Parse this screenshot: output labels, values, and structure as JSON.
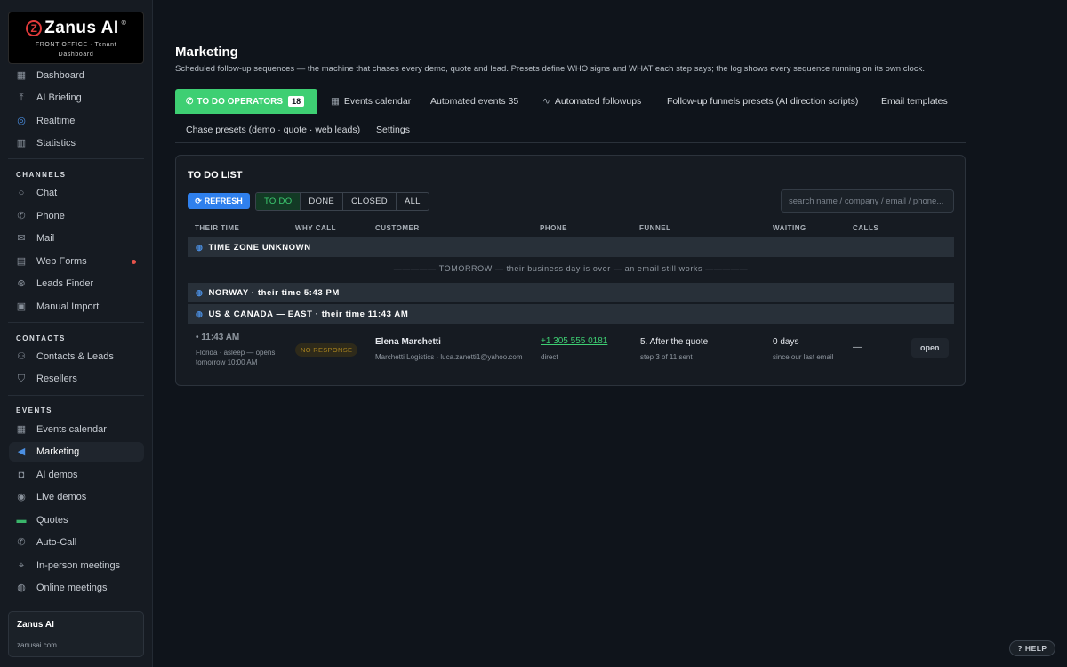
{
  "logo": {
    "letter": "Z",
    "name": "Zanus AI",
    "reg": "®",
    "sub1": "FRONT OFFICE · Tenant",
    "sub2": "Dashboard"
  },
  "sidebar": {
    "top_items": [
      {
        "label": "Dashboard",
        "icon": "grid-icon"
      },
      {
        "label": "AI Briefing",
        "icon": "upload-icon"
      },
      {
        "label": "Realtime",
        "icon": "globe-icon"
      },
      {
        "label": "Statistics",
        "icon": "bar-chart-icon"
      }
    ],
    "channels_label": "CHANNELS",
    "channels": [
      {
        "label": "Chat",
        "icon": "chat-icon"
      },
      {
        "label": "Phone",
        "icon": "phone-icon"
      },
      {
        "label": "Mail",
        "icon": "mail-icon"
      },
      {
        "label": "Web Forms",
        "icon": "form-icon"
      },
      {
        "label": "Leads Finder",
        "icon": "target-icon"
      },
      {
        "label": "Manual Import",
        "icon": "import-icon"
      }
    ],
    "contacts_label": "CONTACTS",
    "contacts": [
      {
        "label": "Contacts & Leads",
        "icon": "users-icon"
      },
      {
        "label": "Resellers",
        "icon": "handshake-icon"
      }
    ],
    "events_label": "EVENTS",
    "events": [
      {
        "label": "Events calendar",
        "icon": "calendar-icon"
      },
      {
        "label": "Marketing",
        "icon": "megaphone-icon"
      },
      {
        "label": "AI demos",
        "icon": "robot-icon"
      },
      {
        "label": "Live demos",
        "icon": "video-icon"
      },
      {
        "label": "Quotes",
        "icon": "quote-icon"
      },
      {
        "label": "Auto-Call",
        "icon": "auto-call-icon"
      },
      {
        "label": "In-person meetings",
        "icon": "pin-icon"
      },
      {
        "label": "Online meetings",
        "icon": "online-meeting-icon"
      }
    ],
    "brand": {
      "name": "Zanus AI",
      "url": "zanusai.com"
    }
  },
  "page": {
    "title": "Marketing",
    "description": "Scheduled follow-up sequences — the machine that chases every demo, quote and lead. Presets define WHO signs and WHAT each step says; the log shows every sequence running on its own clock."
  },
  "tabs": {
    "todo_label": "TO DO OPERATORS",
    "todo_count": "18",
    "events_calendar": "Events calendar",
    "automated_events": "Automated events 35",
    "automated_followups": "Automated followups",
    "funnels_presets": "Follow-up funnels presets (AI direction scripts)",
    "email_templates": "Email templates",
    "chase_presets": "Chase presets (demo · quote · web leads)",
    "settings": "Settings"
  },
  "todo": {
    "title": "TO DO LIST",
    "refresh": "REFRESH",
    "filters": [
      "TO DO",
      "DONE",
      "CLOSED",
      "ALL"
    ],
    "search_placeholder": "search name / company / email / phone...",
    "columns": [
      "THEIR TIME",
      "WHY CALL",
      "CUSTOMER",
      "PHONE",
      "FUNNEL",
      "WAITING",
      "CALLS"
    ],
    "groups": {
      "unknown": "TIME ZONE UNKNOWN",
      "tomorrow": "————— TOMORROW — their business day is over — an email still works —————",
      "norway": "NORWAY · their time 5:43 PM",
      "us_east": "US & CANADA — EAST · their time 11:43 AM"
    },
    "row": {
      "time": "• 11:43 AM",
      "time_sub1": "Florida · asleep — opens",
      "time_sub2": "tomorrow 10:00 AM",
      "why": "NO RESPONSE",
      "name": "Elena Marchetti",
      "company": "Marchetti Logistics · luca.zanetti1@yahoo.com",
      "phone": "+1 305 555 0181",
      "phone_sub": "direct",
      "funnel": "5. After the quote",
      "funnel_sub": "step 3 of 11 sent",
      "waiting": "0 days",
      "waiting_sub": "since our last email",
      "calls": "—",
      "action": "open"
    }
  },
  "help": "? HELP",
  "colors": {
    "accent_green": "#3ecf73",
    "accent_blue": "#2f80ed",
    "alert_red": "#e5534b"
  }
}
